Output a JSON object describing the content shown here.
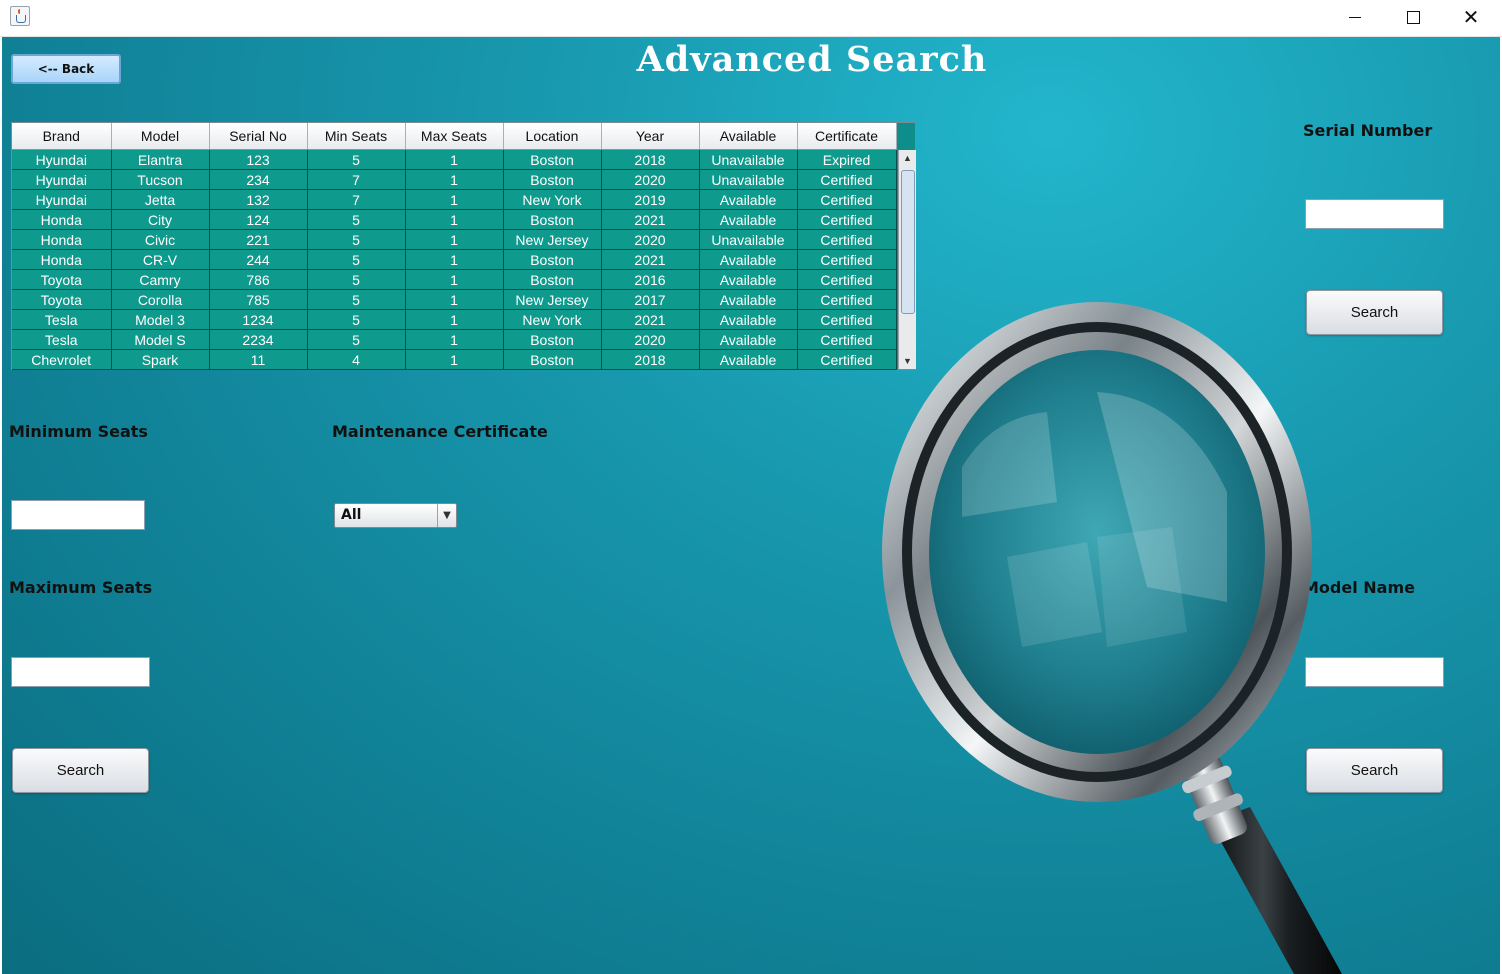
{
  "page": {
    "title": "Advanced Search",
    "back_label": "<-- Back"
  },
  "icons": {
    "app": "java-app-icon",
    "minimize": "minimize-icon",
    "maximize": "maximize-icon",
    "close": "close-icon",
    "close_glyph": "✕",
    "scroll_up_glyph": "▲",
    "scroll_down_glyph": "▼",
    "dropdown_glyph": "▼",
    "decoration": "magnifying-glass-icon"
  },
  "table": {
    "columns": [
      "Brand",
      "Model",
      "Serial No",
      "Min Seats",
      "Max Seats",
      "Location",
      "Year",
      "Available",
      "Certificate"
    ],
    "rows": [
      [
        "Hyundai",
        "Elantra",
        "123",
        "5",
        "1",
        "Boston",
        "2018",
        "Unavailable",
        "Expired"
      ],
      [
        "Hyundai",
        "Tucson",
        "234",
        "7",
        "1",
        "Boston",
        "2020",
        "Unavailable",
        "Certified"
      ],
      [
        "Hyundai",
        "Jetta",
        "132",
        "7",
        "1",
        "New York",
        "2019",
        "Available",
        "Certified"
      ],
      [
        "Honda",
        "City",
        "124",
        "5",
        "1",
        "Boston",
        "2021",
        "Available",
        "Certified"
      ],
      [
        "Honda",
        "Civic",
        "221",
        "5",
        "1",
        "New Jersey",
        "2020",
        "Unavailable",
        "Certified"
      ],
      [
        "Honda",
        "CR-V",
        "244",
        "5",
        "1",
        "Boston",
        "2021",
        "Available",
        "Certified"
      ],
      [
        "Toyota",
        "Camry",
        "786",
        "5",
        "1",
        "Boston",
        "2016",
        "Available",
        "Certified"
      ],
      [
        "Toyota",
        "Corolla",
        "785",
        "5",
        "1",
        "New Jersey",
        "2017",
        "Available",
        "Certified"
      ],
      [
        "Tesla",
        "Model 3",
        "1234",
        "5",
        "1",
        "New York",
        "2021",
        "Available",
        "Certified"
      ],
      [
        "Tesla",
        "Model S",
        "2234",
        "5",
        "1",
        "Boston",
        "2020",
        "Available",
        "Certified"
      ],
      [
        "Chevrolet",
        "Spark",
        "11",
        "4",
        "1",
        "Boston",
        "2018",
        "Available",
        "Certified"
      ]
    ]
  },
  "filters": {
    "min_seats": {
      "label": "Minimum Seats",
      "value": ""
    },
    "max_seats": {
      "label": "Maximum Seats",
      "value": ""
    },
    "seats_search_label": "Search",
    "certificate": {
      "label": "Maintenance Certificate",
      "selected": "All"
    },
    "serial": {
      "label": "Serial Number",
      "value": "",
      "search_label": "Search"
    },
    "model": {
      "label": "Model Name",
      "value": "",
      "search_label": "Search"
    }
  }
}
